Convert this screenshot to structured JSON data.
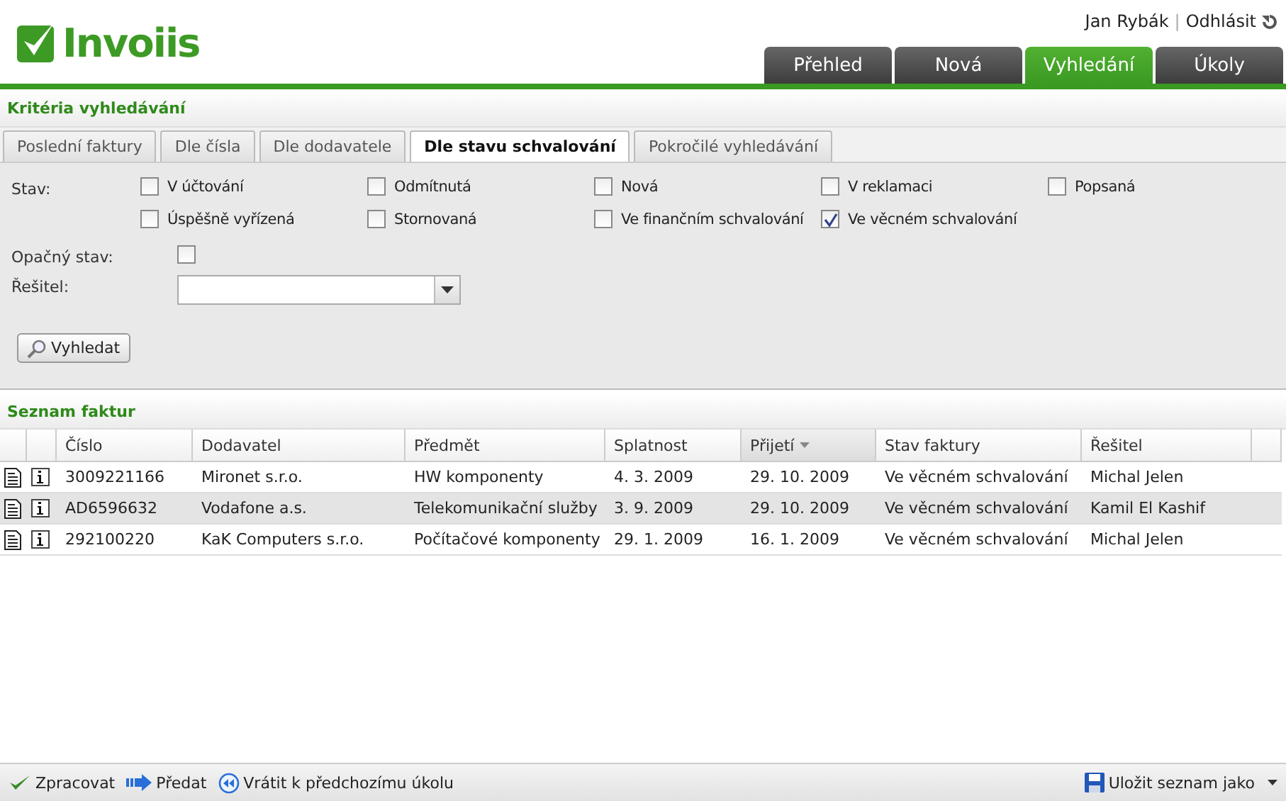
{
  "logo": "Invoiis",
  "user": {
    "name": "Jan Rybák",
    "separator": "|",
    "logout": "Odhlásit"
  },
  "main_tabs": [
    {
      "label": "Přehled",
      "selected": false
    },
    {
      "label": "Nová",
      "selected": false
    },
    {
      "label": "Vyhledání",
      "selected": true
    },
    {
      "label": "Úkoly",
      "selected": false
    }
  ],
  "criteria_title": "Kritéria vyhledávání",
  "sub_tabs": [
    {
      "label": "Poslední faktury",
      "selected": false
    },
    {
      "label": "Dle čísla",
      "selected": false
    },
    {
      "label": "Dle dodavatele",
      "selected": false
    },
    {
      "label": "Dle stavu schvalování",
      "selected": true
    },
    {
      "label": "Pokročilé vyhledávání",
      "selected": false
    }
  ],
  "state_label": "Stav:",
  "states": [
    {
      "label": "V účtování",
      "checked": false
    },
    {
      "label": "Odmítnutá",
      "checked": false
    },
    {
      "label": "Nová",
      "checked": false
    },
    {
      "label": "V reklamaci",
      "checked": false
    },
    {
      "label": "Popsaná",
      "checked": false
    },
    {
      "label": "Úspěšně vyřízená",
      "checked": false
    },
    {
      "label": "Stornovaná",
      "checked": false
    },
    {
      "label": "Ve finančním schvalování",
      "checked": false
    },
    {
      "label": "Ve věcném schvalování",
      "checked": true
    }
  ],
  "opposite": {
    "label": "Opačný stav:",
    "checked": false
  },
  "solver": {
    "label": "Řešitel:"
  },
  "search_button": "Vyhledat",
  "list_title": "Seznam faktur",
  "table": {
    "columns": [
      {
        "label": "Číslo",
        "sorted": false
      },
      {
        "label": "Dodavatel",
        "sorted": false
      },
      {
        "label": "Předmět",
        "sorted": false
      },
      {
        "label": "Splatnost",
        "sorted": false
      },
      {
        "label": "Přijetí",
        "sorted": true
      },
      {
        "label": "Stav faktury",
        "sorted": false
      },
      {
        "label": "Řešitel",
        "sorted": false
      }
    ],
    "rows": [
      {
        "selected": false,
        "cells": [
          "3009221166",
          "Mironet s.r.o.",
          "HW komponenty",
          "4. 3. 2009",
          "29. 10. 2009",
          "Ve věcném schvalování",
          "Michal Jelen"
        ]
      },
      {
        "selected": true,
        "cells": [
          "AD6596632",
          "Vodafone a.s.",
          "Telekomunikační služby",
          "3. 9. 2009",
          "29. 10. 2009",
          "Ve věcném schvalování",
          "Kamil El Kashif"
        ]
      },
      {
        "selected": false,
        "cells": [
          "292100220",
          "KaK Computers s.r.o.",
          "Počítačové komponenty",
          "29. 1. 2009",
          "16. 1. 2009",
          "Ve věcném schvalování",
          "Michal Jelen"
        ]
      }
    ]
  },
  "toolbar": [
    {
      "kind": "check",
      "label": "Zpracovat"
    },
    {
      "kind": "forward",
      "label": "Předat"
    },
    {
      "kind": "back",
      "label": "Vrátit k předchozímu úkolu"
    }
  ],
  "save": "Uložit seznam jako"
}
